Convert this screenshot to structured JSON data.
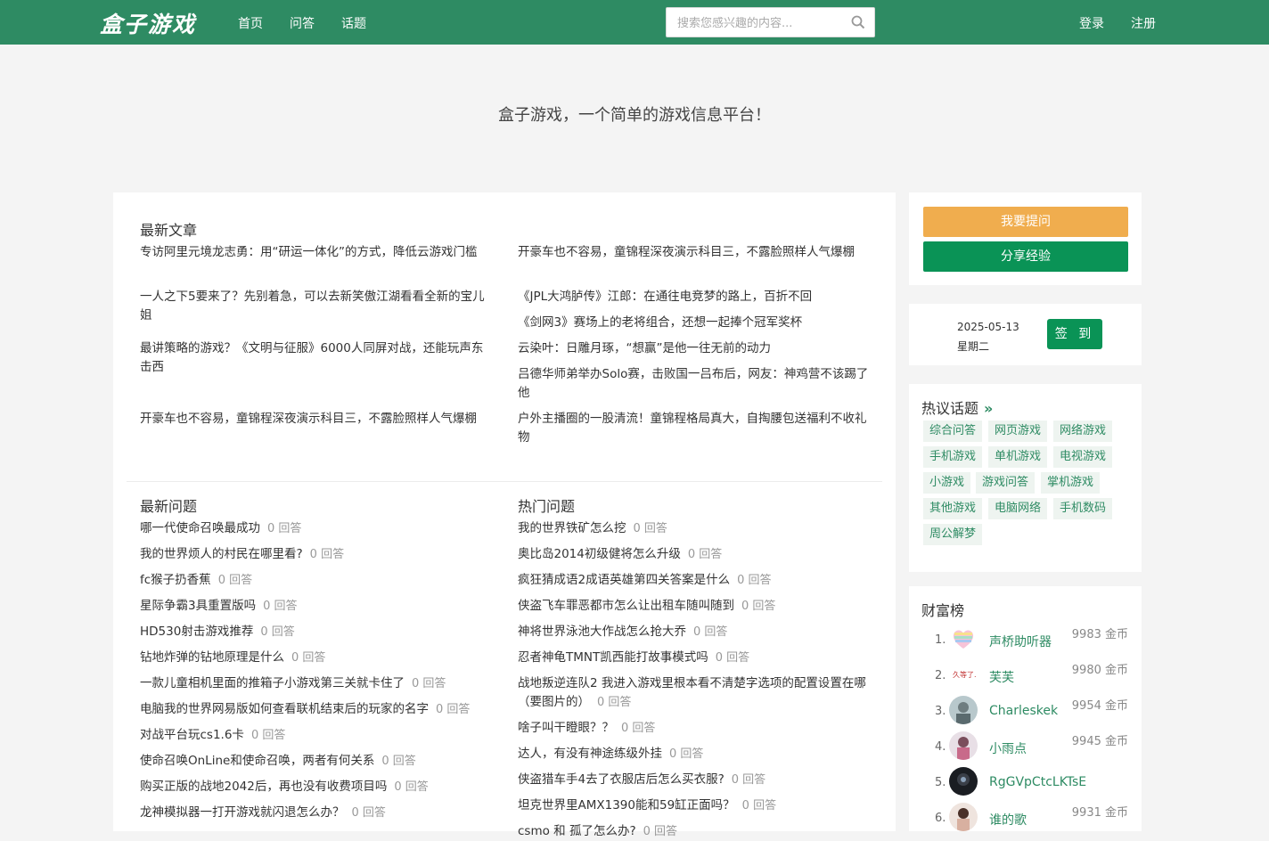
{
  "header": {
    "logo": "盒子游戏",
    "nav": [
      "首页",
      "问答",
      "话题"
    ],
    "search_placeholder": "搜索您感兴趣的内容...",
    "login": "登录",
    "register": "注册"
  },
  "hero": {
    "slogan": "盒子游戏，一个简单的游戏信息平台！"
  },
  "articles": {
    "title": "最新文章",
    "left": [
      "专访阿里元境龙志勇：用“研运一体化”的方式，降低云游戏门槛",
      "一人之下5要来了？先别着急，可以去新笑傲江湖看看全新的宝儿姐",
      "最讲策略的游戏？《文明与征服》6000人同屏对战，还能玩声东击西",
      "开豪车也不容易，童锦程深夜演示科目三，不露脸照样人气爆棚"
    ],
    "right": [
      "开豪车也不容易，童锦程深夜演示科目三，不露脸照样人气爆棚",
      "《JPL大鸿胪传》江郎：在通往电竞梦的路上，百折不回",
      "《剑网3》赛场上的老将组合，还想一起捧个冠军奖杯",
      "云染叶：日雕月琢，“想赢”是他一往无前的动力",
      "吕德华师弟举办Solo赛，击败国一吕布后，网友：神鸡营不该踢了他",
      "户外主播圈的一股清流！童锦程格局真大，自掏腰包送福利不收礼物"
    ]
  },
  "latest_questions": {
    "title": "最新问题",
    "items": [
      {
        "q": "哪一代使命召唤最成功",
        "a": "0 回答"
      },
      {
        "q": "我的世界烦人的村民在哪里看?",
        "a": "0 回答"
      },
      {
        "q": "fc猴子扔香蕉",
        "a": "0 回答"
      },
      {
        "q": "星际争霸3具重置版吗",
        "a": "0 回答"
      },
      {
        "q": "HD530射击游戏推荐",
        "a": "0 回答"
      },
      {
        "q": "钻地炸弹的钻地原理是什么",
        "a": "0 回答"
      },
      {
        "q": "一款儿童相机里面的推箱子小游戏第三关就卡住了",
        "a": "0 回答"
      },
      {
        "q": "电脑我的世界网易版如何查看联机结束后的玩家的名字",
        "a": "0 回答"
      },
      {
        "q": "对战平台玩cs1.6卡",
        "a": "0 回答"
      },
      {
        "q": "使命召唤OnLine和使命召唤，两者有何关系",
        "a": "0 回答"
      },
      {
        "q": "购买正版的战地2042后，再也没有收费项目吗",
        "a": "0 回答"
      },
      {
        "q": "龙神模拟器一打开游戏就闪退怎么办？",
        "a": "0 回答"
      }
    ]
  },
  "hot_questions": {
    "title": "热门问题",
    "items": [
      {
        "q": "我的世界铁矿怎么挖",
        "a": "0 回答"
      },
      {
        "q": "奥比岛2014初级健将怎么升级",
        "a": "0 回答"
      },
      {
        "q": "疯狂猜成语2成语英雄第四关答案是什么",
        "a": "0 回答"
      },
      {
        "q": "侠盗飞车罪恶都市怎么让出租车随叫随到",
        "a": "0 回答"
      },
      {
        "q": "神将世界泳池大作战怎么抢大乔",
        "a": "0 回答"
      },
      {
        "q": "忍者神龟TMNT凯西能打故事模式吗",
        "a": "0 回答"
      },
      {
        "q": "战地叛逆连队2 我进入游戏里根本看不清楚字选项的配置设置在哪（要图片的）",
        "a": "0 回答"
      },
      {
        "q": "啥子叫干瞪眼？？",
        "a": "0 回答"
      },
      {
        "q": "达人，有没有神途练级外挂",
        "a": "0 回答"
      },
      {
        "q": "侠盗猎车手4去了衣服店后怎么买衣服?",
        "a": "0 回答"
      },
      {
        "q": "坦克世界里AMX1390能和59缸正面吗？",
        "a": "0 回答"
      },
      {
        "q": "csmo 和 孤了怎么办?",
        "a": "0 回答"
      }
    ]
  },
  "actions": {
    "ask": "我要提问",
    "share": "分享经验"
  },
  "signin": {
    "date": "2025-05-13",
    "weekday": "星期二",
    "button": "签 到"
  },
  "topics": {
    "title": "热议话题",
    "more": "»",
    "tags": [
      "综合问答",
      "网页游戏",
      "网络游戏",
      "手机游戏",
      "单机游戏",
      "电视游戏",
      "小游戏",
      "游戏问答",
      "掌机游戏",
      "其他游戏",
      "电脑网络",
      "手机数码",
      "周公解梦"
    ]
  },
  "wealth": {
    "title": "财富榜",
    "ranks": [
      {
        "num": "1.",
        "name": "声桥助听器",
        "coins": "9983 金币"
      },
      {
        "num": "2.",
        "name": "芙芙",
        "coins": "9980 金币"
      },
      {
        "num": "3.",
        "name": "Charleskek",
        "coins": "9954 金币"
      },
      {
        "num": "4.",
        "name": "小雨点",
        "coins": "9945 金币"
      },
      {
        "num": "5.",
        "name": "RgGVpCtcLKTsE",
        "coins": ""
      },
      {
        "num": "6.",
        "name": "谁的歌",
        "coins": "9931 金币"
      }
    ]
  }
}
